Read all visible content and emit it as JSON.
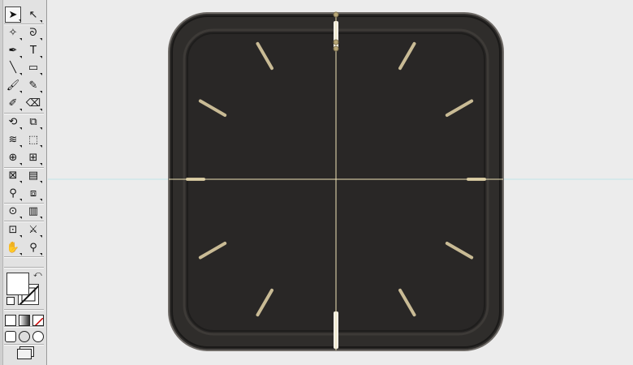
{
  "app": {
    "accent_guide_color": "#bfe3e8",
    "crosshair_color": "#efe3b6"
  },
  "toolbar": {
    "tools": [
      {
        "name": "selection-tool",
        "icon": "arrow-icon",
        "glyph": "➤",
        "selected": true
      },
      {
        "name": "direct-selection-tool",
        "icon": "white-arrow-icon",
        "glyph": "↖"
      },
      {
        "name": "magic-wand-tool",
        "icon": "magic-wand-icon",
        "glyph": "✧"
      },
      {
        "name": "lasso-tool",
        "icon": "lasso-icon",
        "glyph": "ᘐ"
      },
      {
        "name": "pen-tool",
        "icon": "pen-nib-icon",
        "glyph": "✒"
      },
      {
        "name": "type-tool",
        "icon": "type-icon",
        "glyph": "T"
      },
      {
        "name": "line-tool",
        "icon": "line-segment-icon",
        "glyph": "╲"
      },
      {
        "name": "rectangle-tool",
        "icon": "rectangle-icon",
        "glyph": "▭"
      },
      {
        "name": "paintbrush-tool",
        "icon": "paintbrush-icon",
        "glyph": "🖌"
      },
      {
        "name": "pencil-tool",
        "icon": "pencil-icon",
        "glyph": "✎"
      },
      {
        "name": "blob-brush-tool",
        "icon": "blob-brush-icon",
        "glyph": "✐"
      },
      {
        "name": "eraser-tool",
        "icon": "eraser-icon",
        "glyph": "⌫"
      },
      {
        "name": "rotate-tool",
        "icon": "rotate-icon",
        "glyph": "⟲"
      },
      {
        "name": "scale-tool",
        "icon": "scale-icon",
        "glyph": "⧉"
      },
      {
        "name": "warp-tool",
        "icon": "warp-icon",
        "glyph": "≋"
      },
      {
        "name": "free-transform-tool",
        "icon": "free-transform-icon",
        "glyph": "⬚"
      },
      {
        "name": "shape-builder-tool",
        "icon": "shape-builder-icon",
        "glyph": "⊕"
      },
      {
        "name": "perspective-grid-tool",
        "icon": "perspective-grid-icon",
        "glyph": "⊞"
      },
      {
        "name": "mesh-tool",
        "icon": "mesh-icon",
        "glyph": "⊠"
      },
      {
        "name": "gradient-tool",
        "icon": "gradient-icon",
        "glyph": "▤"
      },
      {
        "name": "eyedropper-tool",
        "icon": "eyedropper-icon",
        "glyph": "⚲"
      },
      {
        "name": "blend-tool",
        "icon": "blend-icon",
        "glyph": "⧈"
      },
      {
        "name": "symbol-sprayer-tool",
        "icon": "symbol-sprayer-icon",
        "glyph": "⊙"
      },
      {
        "name": "column-graph-tool",
        "icon": "column-graph-icon",
        "glyph": "▥"
      },
      {
        "name": "artboard-tool",
        "icon": "artboard-icon",
        "glyph": "⊡"
      },
      {
        "name": "slice-tool",
        "icon": "slice-knife-icon",
        "glyph": "⚔"
      },
      {
        "name": "hand-tool",
        "icon": "hand-icon",
        "glyph": "✋"
      },
      {
        "name": "zoom-tool",
        "icon": "magnifier-icon",
        "glyph": "⚲"
      }
    ]
  }
}
